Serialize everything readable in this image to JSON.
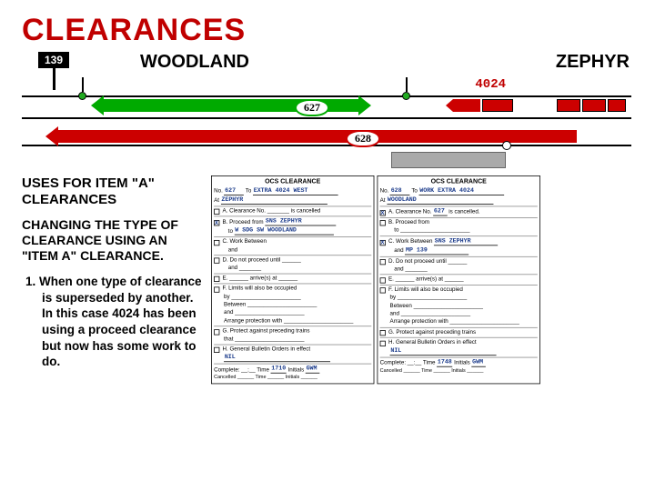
{
  "title": "CLEARANCES",
  "diagram": {
    "signpost": "139",
    "station_left": "WOODLAND",
    "station_right": "ZEPHYR",
    "train_no": "4024",
    "arrow_labels": {
      "top": "627",
      "bottom": "628"
    }
  },
  "left": {
    "heading1": "USES FOR ITEM \"A\" CLEARANCES",
    "heading2": "CHANGING THE TYPE OF CLEARANCE USING AN \"ITEM A\" CLEARANCE.",
    "para": "1.  When one type of clearance is superseded by another.  In this case 4024 has been using a proceed clearance but now has some work to do."
  },
  "form1": {
    "title": "OCS CLEARANCE",
    "no": "627",
    "to": "EXTRA 4024 WEST",
    "at": "ZEPHYR",
    "sec_a": "A. Clearance No. _______ is cancelled",
    "b_from": "SNS ZEPHYR",
    "b_to": "W SDG SW WOODLAND",
    "sec_c": "C. Work Between",
    "and": "and",
    "sec_d": "D. Do not proceed until ______",
    "sec_e_and": "and _______",
    "sec_e_arrive": "E. ______ arrive(s) at ______",
    "sec_f": "F. Limits will also be occupied",
    "by1": "by ______________________",
    "between": "Between ______________________",
    "and2": "and ______________________",
    "arrange": "Arrange protection with ______________________",
    "sec_g": "G. Protect against preceding trains",
    "that": "that ______________________",
    "sec_h": "H. General Bulletin Orders in effect",
    "h_val": "NIL",
    "complete": "Complete:",
    "time": "__:__",
    "time_val": "1710",
    "initials": "Initials",
    "initials_val": "GWM",
    "cancelled": "Cancelled ______ Time ______ Initials ______"
  },
  "form2": {
    "title": "OCS CLEARANCE",
    "no": "628",
    "to": "WORK EXTRA 4024",
    "at": "WOODLAND",
    "a_no": "627",
    "a_tail": "is cancelled.",
    "sec_b": "B. Proceed from",
    "to2": "to ______________________",
    "c_from": "SNS ZEPHYR",
    "c_and": "MP 139",
    "sec_d": "D. Do not proceed until ______",
    "sec_e_and": "and _______",
    "sec_e_arrive": "E. ______ arrive(s) at ______",
    "sec_f": "F. Limits will also be occupied",
    "by1": "by ______________________",
    "between": "Between ______________________",
    "and2": "and ______________________",
    "arrange": "Arrange protection with ______________________",
    "sec_g": "G. Protect against preceding trains",
    "sec_h": "H. General Bulletin Orders in effect",
    "h_val": "NIL",
    "complete": "Complete:",
    "time_val": "1748",
    "initials": "Initials",
    "initials_val": "GWM",
    "cancelled": "Cancelled ______ Time ______ Initials ______"
  }
}
